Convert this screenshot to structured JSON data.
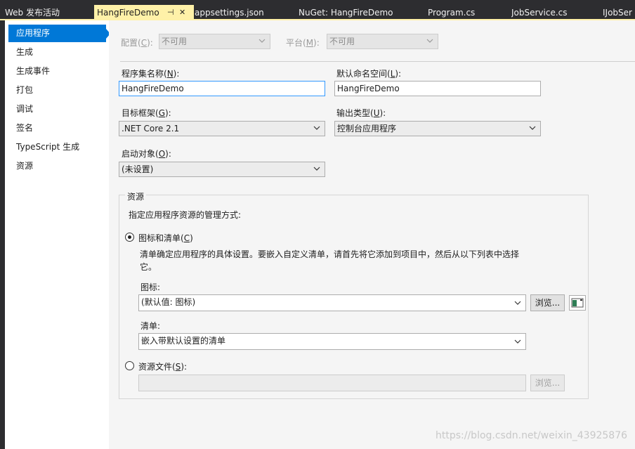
{
  "tabs": [
    {
      "label": "Web 发布活动"
    },
    {
      "label": "HangFireDemo",
      "pin": "⊣",
      "close": "✕"
    },
    {
      "label": "appsettings.json"
    },
    {
      "label": "NuGet: HangFireDemo"
    },
    {
      "label": "Program.cs"
    },
    {
      "label": "JobService.cs"
    },
    {
      "label": "IJobSer"
    }
  ],
  "sidebar": {
    "items": [
      {
        "label": "应用程序"
      },
      {
        "label": "生成"
      },
      {
        "label": "生成事件"
      },
      {
        "label": "打包"
      },
      {
        "label": "调试"
      },
      {
        "label": "签名"
      },
      {
        "label": "TypeScript 生成"
      },
      {
        "label": "资源"
      }
    ]
  },
  "config": {
    "config_label": "配置(",
    "config_key": "C",
    "config_suffix": "):",
    "config_value": "不可用",
    "platform_label": "平台(",
    "platform_key": "M",
    "platform_suffix": "):",
    "platform_value": "不可用"
  },
  "form": {
    "assembly_label": "程序集名称(",
    "assembly_key": "N",
    "assembly_suffix": "):",
    "assembly_value": "HangFireDemo",
    "namespace_label": "默认命名空间(",
    "namespace_key": "L",
    "namespace_suffix": "):",
    "namespace_value": "HangFireDemo",
    "framework_label": "目标框架(",
    "framework_key": "G",
    "framework_suffix": "):",
    "framework_value": ".NET Core 2.1",
    "output_label": "输出类型(",
    "output_key": "U",
    "output_suffix": "):",
    "output_value": "控制台应用程序",
    "startup_label": "启动对象(",
    "startup_key": "O",
    "startup_suffix": "):",
    "startup_value": "(未设置)"
  },
  "resources": {
    "group_title": "资源",
    "description": "指定应用程序资源的管理方式:",
    "option1_label": "图标和清单(",
    "option1_key": "C",
    "option1_suffix": ")",
    "option1_desc_line1": "清单确定应用程序的具体设置。要嵌入自定义清单，请首先将它添加到项目中，然后从以下列表中选择",
    "option1_desc_line2": "它。",
    "icon_label": "图标:",
    "icon_value": "(默认值: 图标)",
    "browse_label": "浏览...",
    "manifest_label": "清单:",
    "manifest_value": "嵌入带默认设置的清单",
    "option2_label": "资源文件(",
    "option2_key": "S",
    "option2_suffix": "):",
    "option2_value": "",
    "browse2_label": "浏览..."
  },
  "watermark": "https://blog.csdn.net/weixin_43925876",
  "colors": {
    "accent": "#0078d7",
    "active_tab": "#fff1a8",
    "chrome": "#2d2d30",
    "panel": "#f5f5f5"
  }
}
